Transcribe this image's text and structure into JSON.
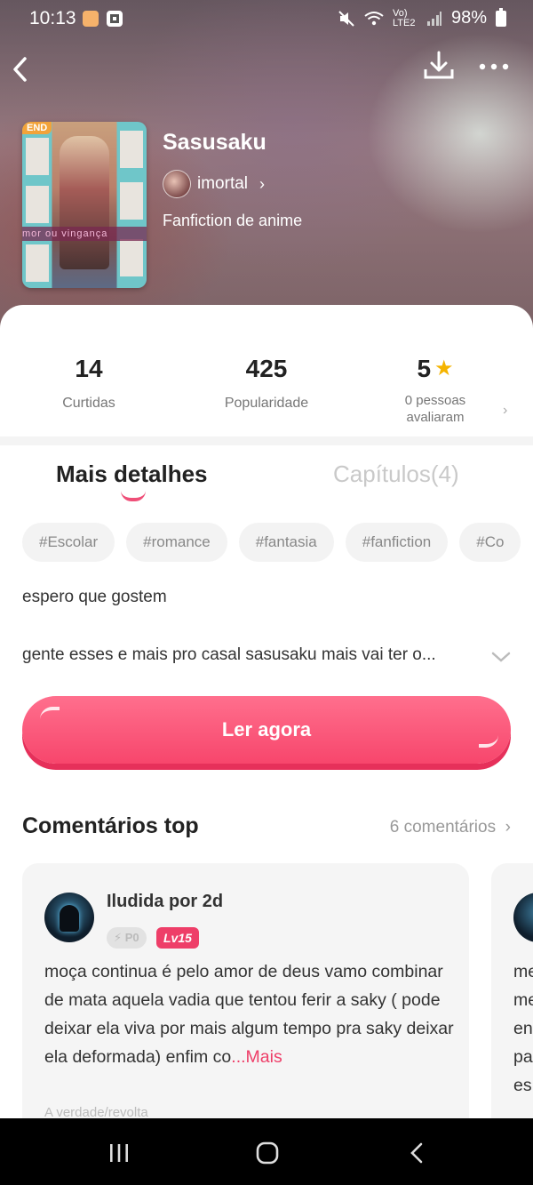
{
  "status_bar": {
    "time": "10:13",
    "network": "Vo) LTE2",
    "battery": "98%"
  },
  "book": {
    "title": "Sasusaku",
    "author": "imortal",
    "genre": "Fanfiction de anime",
    "cover_badge": "END",
    "cover_text": "mor ou vingança"
  },
  "stats": [
    {
      "value": "14",
      "label": "Curtidas"
    },
    {
      "value": "425",
      "label": "Popularidade"
    },
    {
      "value": "5",
      "label": "0 pessoas avaliaram"
    }
  ],
  "tabs": {
    "details": "Mais detalhes",
    "chapters": "Capítulos(4)"
  },
  "tags": [
    "#Escolar",
    "#romance",
    "#fantasia",
    "#fanfiction",
    "#Co"
  ],
  "description": {
    "line1": "espero que gostem",
    "line2": "gente esses e mais pro casal sasusaku mais vai ter o..."
  },
  "read_button": "Ler agora",
  "comments": {
    "title": "Comentários top",
    "count": "6 comentários",
    "items": [
      {
        "user": "Iludida por 2d",
        "points_badge": "P0",
        "level_badge": "Lv15",
        "text": "moça continua é pelo amor de deus vamo combinar de mata aquela vadia que tentou ferir a saky ( pode deixar ela viva por mais algum tempo pra saky deixar ela deformada) enfim co",
        "more": "...Mais",
        "footer": "A verdade/revolta"
      }
    ],
    "second_preview": "me\nme\nen\npa\nes"
  },
  "colors": {
    "accent": "#ef4f78",
    "star": "#f5b400",
    "tag_bg": "#f3f3f3"
  }
}
